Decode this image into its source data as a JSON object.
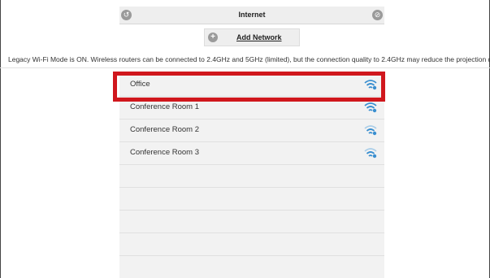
{
  "header": {
    "title": "Internet"
  },
  "add_network": {
    "label": "Add Network"
  },
  "info": {
    "text": "Legacy Wi-Fi Mode is ON. Wireless routers can be connected to 2.4GHz and 5GHz (limited), but the connection quality to 2.4GHz may reduce the projection quality"
  },
  "networks": [
    {
      "name": "Office",
      "signal": "strong"
    },
    {
      "name": "Conference Room 1",
      "signal": "strong"
    },
    {
      "name": "Conference Room 2",
      "signal": "medium"
    },
    {
      "name": "Conference Room 3",
      "signal": "medium"
    }
  ],
  "colors": {
    "highlight": "#d0171d",
    "wifi_strong": "#3a8fd0",
    "wifi_weak": "#a9cde8",
    "row_bg": "#f2f2f2"
  }
}
